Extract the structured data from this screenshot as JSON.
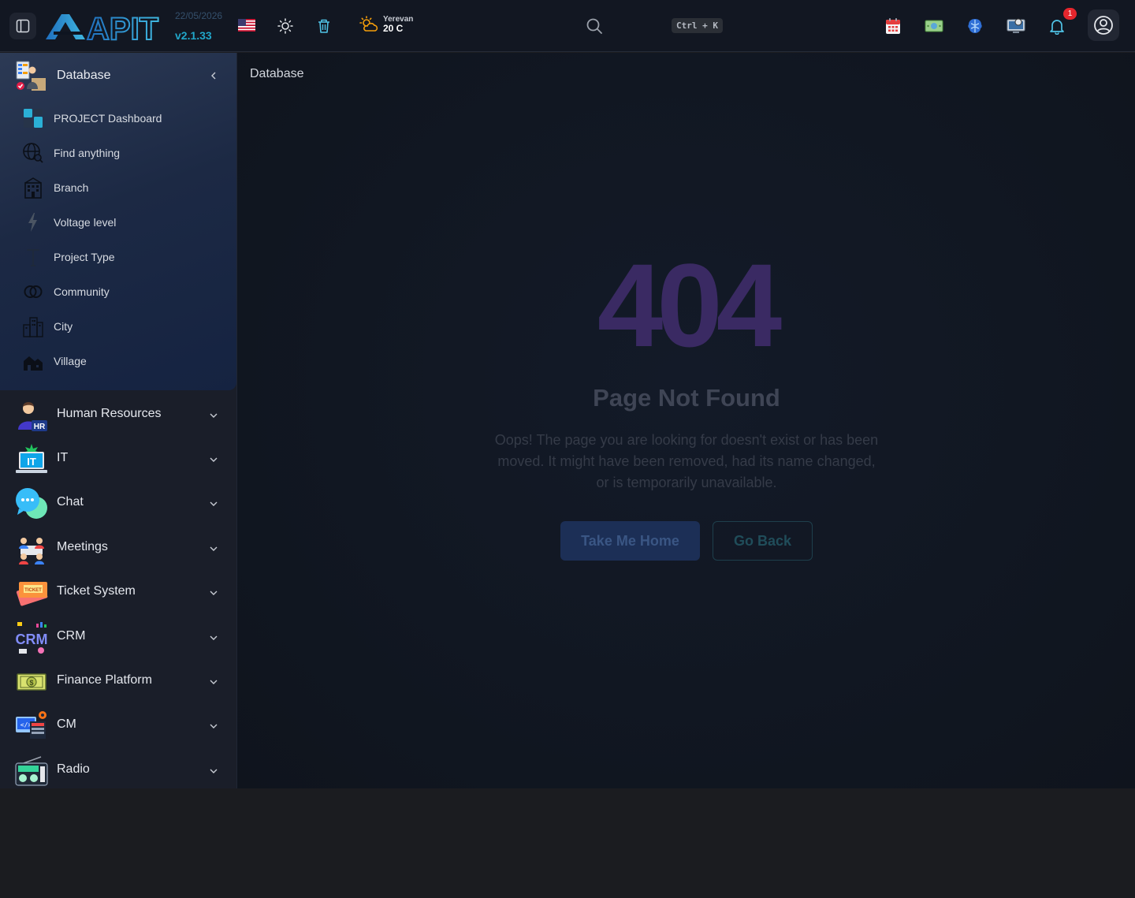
{
  "header": {
    "logo_text": "APIT",
    "date": "22/05/2026",
    "version": "v2.1.33",
    "weather": {
      "city": "Yerevan",
      "temp": "20 C"
    },
    "search_shortcut": "Ctrl + K",
    "notification_count": "1",
    "icons": [
      "sidebar-toggle-icon",
      "us-flag-icon",
      "sun-icon",
      "trash-icon",
      "weather-icon",
      "search-icon",
      "calendar-icon",
      "money-icon",
      "brain-icon",
      "monitor-icon",
      "bell-icon",
      "user-circle-icon"
    ]
  },
  "sidebar": {
    "active_group": {
      "label": "Database",
      "items": [
        {
          "label": "PROJECT Dashboard",
          "icon": "dashboard-icon"
        },
        {
          "label": "Find anything",
          "icon": "globe-search-icon"
        },
        {
          "label": "Branch",
          "icon": "building-icon"
        },
        {
          "label": "Voltage level",
          "icon": "lightning-icon"
        },
        {
          "label": "Project Type",
          "icon": "type-icon"
        },
        {
          "label": "Community",
          "icon": "rings-icon"
        },
        {
          "label": "City",
          "icon": "city-icon"
        },
        {
          "label": "Village",
          "icon": "village-icon"
        }
      ]
    },
    "groups": [
      {
        "label": "Human Resources",
        "icon": "hr-icon"
      },
      {
        "label": "IT",
        "icon": "it-laptop-icon"
      },
      {
        "label": "Chat",
        "icon": "chat-bubbles-icon"
      },
      {
        "label": "Meetings",
        "icon": "meeting-icon"
      },
      {
        "label": "Ticket System",
        "icon": "ticket-icon"
      },
      {
        "label": "CRM",
        "icon": "crm-icon"
      },
      {
        "label": "Finance Platform",
        "icon": "banknote-icon"
      },
      {
        "label": "CM",
        "icon": "cm-icon"
      },
      {
        "label": "Radio",
        "icon": "radio-icon"
      }
    ]
  },
  "main": {
    "breadcrumb": "Database",
    "error_code": "404",
    "title": "Page Not Found",
    "description": "Oops! The page you are looking for doesn't exist or has been moved. It might have been removed, had its name changed, or is temporarily unavailable.",
    "home_button": "Take Me Home",
    "back_button": "Go Back"
  },
  "colors": {
    "accent": "#21a6c9",
    "error_code": "#3a2a63",
    "badge": "#e5262d",
    "sidebar_active": "#1c2944"
  }
}
